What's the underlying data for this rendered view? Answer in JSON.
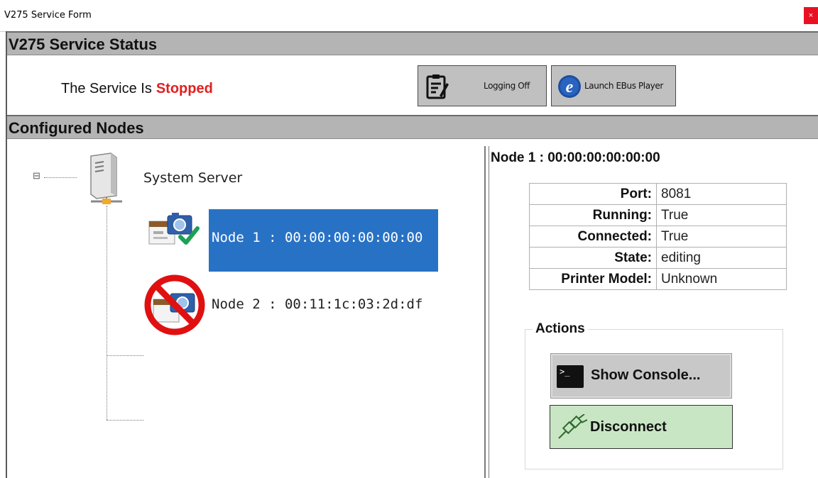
{
  "window": {
    "title": "V275 Service Form",
    "close_glyph": "×"
  },
  "status_section": {
    "header": "V275 Service Status",
    "label": "The Service Is",
    "value": "Stopped",
    "value_color": "#e02020",
    "logging_button": {
      "label": "Logging Off",
      "icon": "clipboard-icon"
    },
    "ebus_button": {
      "label": "Launch EBus Player",
      "icon": "ebus-e-icon"
    }
  },
  "nodes_section": {
    "header": "Configured Nodes",
    "tree": {
      "collapse_glyph": "⊟",
      "root": {
        "label": "System Server",
        "icon": "server-icon"
      },
      "children": [
        {
          "label": "Node 1 : 00:00:00:00:00:00",
          "icon": "camera-check-icon",
          "selected": true
        },
        {
          "label": "Node 2 : 00:11:1c:03:2d:df",
          "icon": "camera-disabled-icon",
          "selected": false
        }
      ]
    }
  },
  "detail": {
    "title": "Node 1 : 00:00:00:00:00:00",
    "properties": [
      {
        "key": "Port:",
        "value": "8081"
      },
      {
        "key": "Running:",
        "value": "True"
      },
      {
        "key": "Connected:",
        "value": "True"
      },
      {
        "key": "State:",
        "value": "editing"
      },
      {
        "key": "Printer Model:",
        "value": "Unknown"
      }
    ],
    "actions": {
      "legend": "Actions",
      "console_button": {
        "label": "Show Console...",
        "icon": "terminal-icon",
        "prompt_glyph": ">_"
      },
      "disconnect_button": {
        "label": "Disconnect",
        "icon": "plug-icon",
        "bg": "#c8e6c4"
      }
    }
  },
  "colors": {
    "selection": "#2872c5",
    "section_header": "#b4b4b4",
    "button_gray": "#c0c0c0"
  }
}
